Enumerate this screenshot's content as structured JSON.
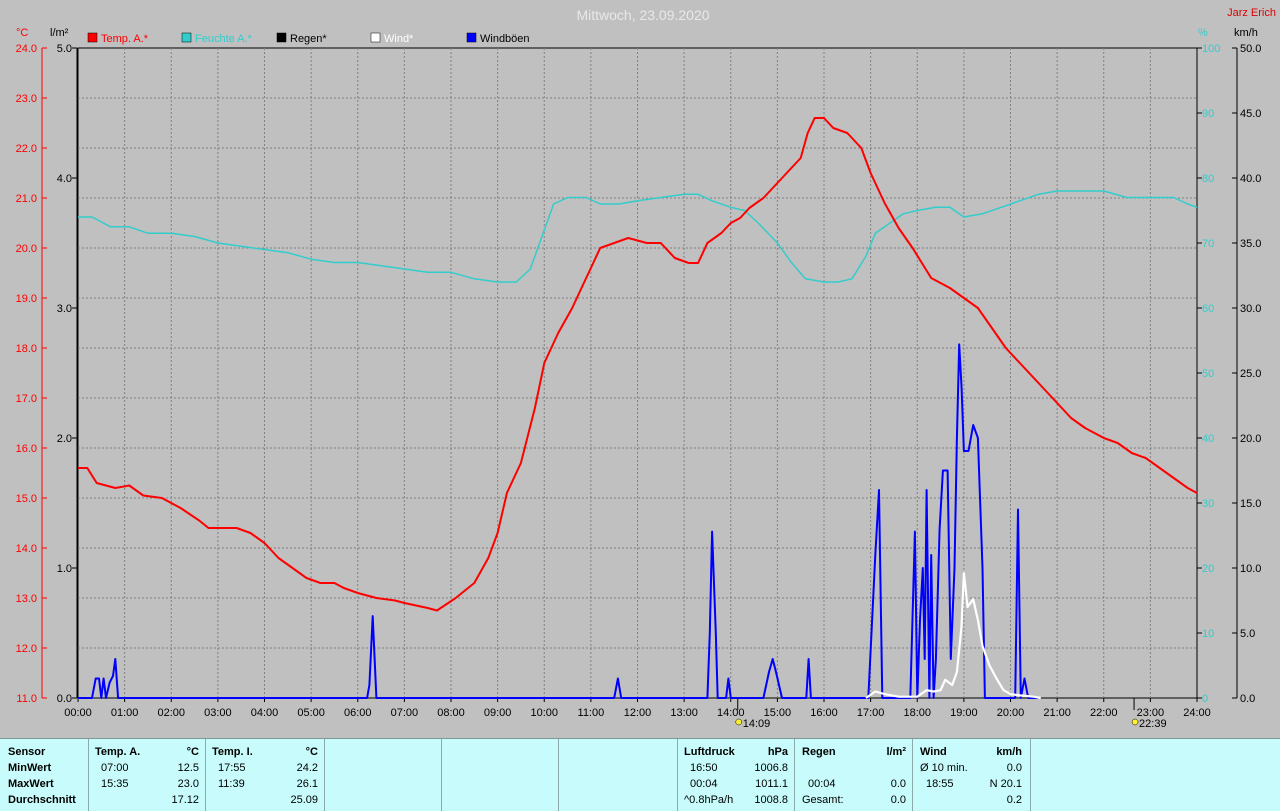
{
  "title": "Mittwoch, 23.09.2020",
  "author": "Jarz Erich",
  "colors": {
    "background": "#c0c0c0",
    "temp": "#ff0000",
    "humidity": "#33cccc",
    "rain": "#000000",
    "wind": "#ffffff",
    "gust": "#0000ff",
    "grid": "#808080",
    "panel": "#c8fcfc"
  },
  "axes_units": {
    "temp": "°C",
    "rain": "l/m²",
    "humidity": "%",
    "wind": "km/h"
  },
  "markers": [
    {
      "label": "14:09",
      "icon": "sunrise-icon"
    },
    {
      "label": "22:39",
      "icon": "moon-icon"
    }
  ],
  "chart_data": {
    "type": "line",
    "title": "Mittwoch, 23.09.2020",
    "x": {
      "unit": "hour",
      "range": [
        0,
        24
      ],
      "tick_labels": [
        "00:00",
        "01:00",
        "02:00",
        "03:00",
        "04:00",
        "05:00",
        "06:00",
        "07:00",
        "08:00",
        "09:00",
        "10:00",
        "11:00",
        "12:00",
        "13:00",
        "14:00",
        "15:00",
        "16:00",
        "17:00",
        "18:00",
        "19:00",
        "20:00",
        "21:00",
        "22:00",
        "23:00",
        "24:00"
      ]
    },
    "axes": {
      "temp": {
        "label": "°C",
        "range": [
          11.0,
          24.0
        ],
        "ticks": [
          "11.0",
          "12.0",
          "13.0",
          "14.0",
          "15.0",
          "16.0",
          "17.0",
          "18.0",
          "19.0",
          "20.0",
          "21.0",
          "22.0",
          "23.0",
          "24.0"
        ]
      },
      "rain": {
        "label": "l/m²",
        "range": [
          0.0,
          5.0
        ],
        "ticks": [
          "0.0",
          "1.0",
          "2.0",
          "3.0",
          "4.0",
          "5.0"
        ]
      },
      "humidity": {
        "label": "%",
        "range": [
          0,
          100
        ],
        "ticks": [
          "0",
          "10",
          "20",
          "30",
          "40",
          "50",
          "60",
          "70",
          "80",
          "90",
          "100"
        ]
      },
      "wind": {
        "label": "km/h",
        "range": [
          0.0,
          50.0
        ],
        "ticks": [
          "0.0",
          "5.0",
          "10.0",
          "15.0",
          "20.0",
          "25.0",
          "30.0",
          "35.0",
          "40.0",
          "45.0",
          "50.0"
        ]
      }
    },
    "grid": true,
    "legend_position": "top-left",
    "legend": [
      "Temp. A.*",
      "Feuchte A.*",
      "Regen*",
      "Wind*",
      "Windböen"
    ],
    "series": [
      {
        "name": "Temp. A.*",
        "axis": "temp",
        "points": [
          [
            0,
            15.6
          ],
          [
            0.2,
            15.6
          ],
          [
            0.4,
            15.3
          ],
          [
            0.8,
            15.2
          ],
          [
            1.1,
            15.25
          ],
          [
            1.4,
            15.05
          ],
          [
            1.8,
            15.0
          ],
          [
            2.2,
            14.8
          ],
          [
            2.6,
            14.55
          ],
          [
            2.8,
            14.4
          ],
          [
            3.2,
            14.4
          ],
          [
            3.4,
            14.4
          ],
          [
            3.7,
            14.3
          ],
          [
            4.0,
            14.1
          ],
          [
            4.3,
            13.8
          ],
          [
            4.6,
            13.6
          ],
          [
            4.9,
            13.4
          ],
          [
            5.2,
            13.3
          ],
          [
            5.5,
            13.3
          ],
          [
            5.7,
            13.2
          ],
          [
            6.0,
            13.1
          ],
          [
            6.4,
            13.0
          ],
          [
            6.8,
            12.95
          ],
          [
            7.0,
            12.9
          ],
          [
            7.5,
            12.8
          ],
          [
            7.7,
            12.75
          ],
          [
            8.1,
            13.0
          ],
          [
            8.5,
            13.3
          ],
          [
            8.8,
            13.8
          ],
          [
            9.0,
            14.3
          ],
          [
            9.2,
            15.1
          ],
          [
            9.5,
            15.7
          ],
          [
            9.8,
            16.8
          ],
          [
            10.0,
            17.7
          ],
          [
            10.3,
            18.3
          ],
          [
            10.6,
            18.8
          ],
          [
            10.8,
            19.2
          ],
          [
            11.0,
            19.6
          ],
          [
            11.2,
            20.0
          ],
          [
            11.5,
            20.1
          ],
          [
            11.8,
            20.2
          ],
          [
            12.2,
            20.1
          ],
          [
            12.5,
            20.1
          ],
          [
            12.8,
            19.8
          ],
          [
            13.1,
            19.7
          ],
          [
            13.3,
            19.7
          ],
          [
            13.5,
            20.1
          ],
          [
            13.8,
            20.3
          ],
          [
            14.0,
            20.5
          ],
          [
            14.2,
            20.6
          ],
          [
            14.4,
            20.8
          ],
          [
            14.7,
            21.0
          ],
          [
            15.0,
            21.3
          ],
          [
            15.2,
            21.5
          ],
          [
            15.5,
            21.8
          ],
          [
            15.65,
            22.3
          ],
          [
            15.8,
            22.6
          ],
          [
            16.0,
            22.6
          ],
          [
            16.2,
            22.4
          ],
          [
            16.5,
            22.3
          ],
          [
            16.8,
            22.0
          ],
          [
            17.0,
            21.5
          ],
          [
            17.3,
            20.9
          ],
          [
            17.6,
            20.4
          ],
          [
            17.9,
            20.0
          ],
          [
            18.1,
            19.7
          ],
          [
            18.3,
            19.4
          ],
          [
            18.7,
            19.2
          ],
          [
            19.0,
            19.0
          ],
          [
            19.3,
            18.8
          ],
          [
            19.6,
            18.4
          ],
          [
            19.9,
            18.0
          ],
          [
            20.3,
            17.6
          ],
          [
            20.6,
            17.3
          ],
          [
            20.9,
            17.0
          ],
          [
            21.3,
            16.6
          ],
          [
            21.6,
            16.4
          ],
          [
            22.0,
            16.2
          ],
          [
            22.3,
            16.1
          ],
          [
            22.6,
            15.9
          ],
          [
            22.9,
            15.8
          ],
          [
            23.2,
            15.6
          ],
          [
            23.5,
            15.4
          ],
          [
            23.8,
            15.2
          ],
          [
            24.0,
            15.1
          ]
        ]
      },
      {
        "name": "Feuchte A.*",
        "axis": "humidity",
        "points": [
          [
            0,
            74
          ],
          [
            0.3,
            74
          ],
          [
            0.7,
            72.5
          ],
          [
            1.1,
            72.5
          ],
          [
            1.5,
            71.5
          ],
          [
            2.0,
            71.5
          ],
          [
            2.5,
            71
          ],
          [
            3.0,
            70
          ],
          [
            3.5,
            69.5
          ],
          [
            4.0,
            69
          ],
          [
            4.5,
            68.5
          ],
          [
            5.0,
            67.5
          ],
          [
            5.5,
            67
          ],
          [
            6.0,
            67
          ],
          [
            6.5,
            66.5
          ],
          [
            7.0,
            66
          ],
          [
            7.5,
            65.5
          ],
          [
            8.0,
            65.5
          ],
          [
            8.5,
            64.5
          ],
          [
            9.0,
            64
          ],
          [
            9.4,
            64
          ],
          [
            9.7,
            66
          ],
          [
            10.0,
            72
          ],
          [
            10.2,
            76
          ],
          [
            10.5,
            77
          ],
          [
            10.9,
            77
          ],
          [
            11.2,
            76
          ],
          [
            11.6,
            76
          ],
          [
            12.0,
            76.5
          ],
          [
            12.5,
            77
          ],
          [
            13.0,
            77.5
          ],
          [
            13.3,
            77.5
          ],
          [
            13.6,
            76.5
          ],
          [
            14.0,
            75.5
          ],
          [
            14.3,
            75
          ],
          [
            14.6,
            73
          ],
          [
            15.0,
            70
          ],
          [
            15.3,
            67
          ],
          [
            15.6,
            64.5
          ],
          [
            16.0,
            64
          ],
          [
            16.3,
            64
          ],
          [
            16.6,
            64.5
          ],
          [
            16.9,
            68
          ],
          [
            17.1,
            71.5
          ],
          [
            17.4,
            73
          ],
          [
            17.7,
            74.5
          ],
          [
            18.0,
            75
          ],
          [
            18.4,
            75.5
          ],
          [
            18.7,
            75.5
          ],
          [
            19.0,
            74
          ],
          [
            19.4,
            74.5
          ],
          [
            19.8,
            75.5
          ],
          [
            20.2,
            76.5
          ],
          [
            20.6,
            77.5
          ],
          [
            21.0,
            78
          ],
          [
            21.5,
            78
          ],
          [
            22.0,
            78
          ],
          [
            22.5,
            77
          ],
          [
            23.0,
            77
          ],
          [
            23.5,
            77
          ],
          [
            23.8,
            76
          ],
          [
            24.0,
            75.5
          ]
        ]
      },
      {
        "name": "Wind*",
        "axis": "wind",
        "points": [
          [
            16.9,
            0
          ],
          [
            17.1,
            0.5
          ],
          [
            17.3,
            0.3
          ],
          [
            17.6,
            0.1
          ],
          [
            18.0,
            0.1
          ],
          [
            18.2,
            0.6
          ],
          [
            18.35,
            0.5
          ],
          [
            18.5,
            0.6
          ],
          [
            18.6,
            1.4
          ],
          [
            18.75,
            1.0
          ],
          [
            18.85,
            2.0
          ],
          [
            18.95,
            5.5
          ],
          [
            19.0,
            9.6
          ],
          [
            19.08,
            7.0
          ],
          [
            19.2,
            7.6
          ],
          [
            19.3,
            6.0
          ],
          [
            19.4,
            4.0
          ],
          [
            19.55,
            2.5
          ],
          [
            19.7,
            1.5
          ],
          [
            19.85,
            0.6
          ],
          [
            20.0,
            0.3
          ],
          [
            20.2,
            0.2
          ],
          [
            20.5,
            0.1
          ],
          [
            20.65,
            0
          ]
        ]
      },
      {
        "name": "Windböen",
        "axis": "wind",
        "points": [
          [
            0,
            0
          ],
          [
            0.3,
            0
          ],
          [
            0.38,
            1.5
          ],
          [
            0.45,
            1.5
          ],
          [
            0.5,
            0
          ],
          [
            0.55,
            1.5
          ],
          [
            0.6,
            0
          ],
          [
            0.68,
            1.2
          ],
          [
            0.75,
            1.7
          ],
          [
            0.8,
            3.0
          ],
          [
            0.86,
            0
          ],
          [
            6.2,
            0
          ],
          [
            6.25,
            1.0
          ],
          [
            6.32,
            6.3
          ],
          [
            6.4,
            0
          ],
          [
            11.5,
            0
          ],
          [
            11.58,
            1.5
          ],
          [
            11.65,
            0
          ],
          [
            13.5,
            0
          ],
          [
            13.55,
            5.0
          ],
          [
            13.6,
            12.8
          ],
          [
            13.68,
            5.0
          ],
          [
            13.72,
            0
          ],
          [
            13.9,
            0
          ],
          [
            13.95,
            1.5
          ],
          [
            14.0,
            0
          ],
          [
            14.7,
            0
          ],
          [
            14.82,
            2.0
          ],
          [
            14.9,
            3.0
          ],
          [
            14.97,
            2.0
          ],
          [
            15.1,
            0
          ],
          [
            15.62,
            0
          ],
          [
            15.67,
            3.0
          ],
          [
            15.72,
            0
          ],
          [
            16.95,
            0
          ],
          [
            17.1,
            11.0
          ],
          [
            17.18,
            16.0
          ],
          [
            17.25,
            0
          ],
          [
            17.85,
            0
          ],
          [
            17.95,
            12.8
          ],
          [
            18.0,
            0
          ],
          [
            18.06,
            6.0
          ],
          [
            18.12,
            10.0
          ],
          [
            18.16,
            3.0
          ],
          [
            18.2,
            16.0
          ],
          [
            18.26,
            0
          ],
          [
            18.3,
            11.0
          ],
          [
            18.35,
            0
          ],
          [
            18.4,
            3.0
          ],
          [
            18.48,
            13.0
          ],
          [
            18.55,
            17.5
          ],
          [
            18.65,
            17.5
          ],
          [
            18.72,
            3.0
          ],
          [
            18.8,
            10.0
          ],
          [
            18.85,
            20.0
          ],
          [
            18.9,
            27.2
          ],
          [
            18.95,
            24.0
          ],
          [
            19.0,
            19.0
          ],
          [
            19.1,
            19.0
          ],
          [
            19.2,
            21.0
          ],
          [
            19.3,
            20.0
          ],
          [
            19.4,
            10.0
          ],
          [
            19.45,
            0
          ],
          [
            20.1,
            0
          ],
          [
            20.16,
            14.5
          ],
          [
            20.22,
            0
          ],
          [
            20.3,
            1.5
          ],
          [
            20.38,
            0
          ],
          [
            20.6,
            0
          ]
        ]
      }
    ],
    "stats": {
      "header": {
        "sensor": "Sensor",
        "temp_a": "Temp. A.",
        "temp_a_unit": "°C",
        "temp_i": "Temp. I.",
        "temp_i_unit": "°C",
        "pressure": "Luftdruck",
        "pressure_unit": "hPa",
        "rain": "Regen",
        "rain_unit": "l/m²",
        "wind": "Wind",
        "wind_unit": "km/h"
      },
      "rows": [
        {
          "label": "MinWert",
          "temp_a_time": "07:00",
          "temp_a": "12.5",
          "temp_i_time": "17:55",
          "temp_i": "24.2",
          "pressure_time": "16:50",
          "pressure": "1006.8",
          "rain_time": "",
          "rain": "",
          "wind_label": "Ø 10 min.",
          "wind": "0.0"
        },
        {
          "label": "MaxWert",
          "temp_a_time": "15:35",
          "temp_a": "23.0",
          "temp_i_time": "11:39",
          "temp_i": "26.1",
          "pressure_time": "00:04",
          "pressure": "1011.1",
          "rain_time": "00:04",
          "rain": "0.0",
          "wind_label": "18:55",
          "wind": "N 20.1"
        },
        {
          "label": "Durchschnitt",
          "temp_a_time": "",
          "temp_a": "17.12",
          "temp_i_time": "",
          "temp_i": "25.09",
          "pressure_time": "^0.8hPa/h",
          "pressure": "1008.8",
          "rain_time": "Gesamt:",
          "rain": "0.0",
          "wind_label": "",
          "wind": "0.2"
        }
      ]
    }
  }
}
